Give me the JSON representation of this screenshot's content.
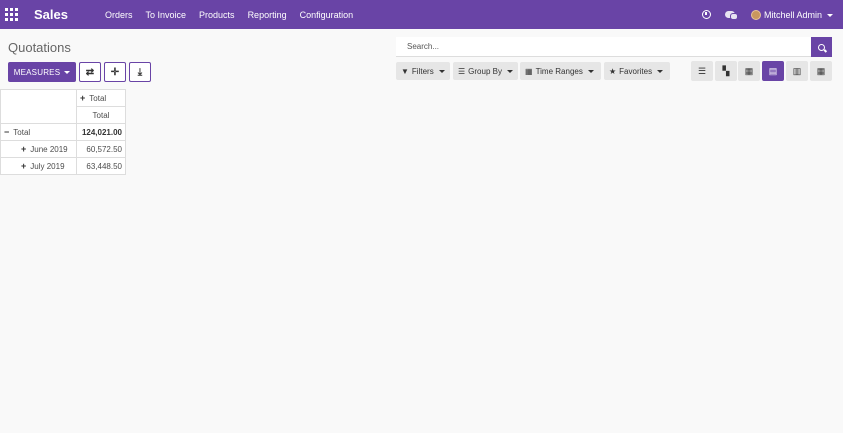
{
  "app": {
    "name": "Sales"
  },
  "nav": {
    "menu": [
      "Orders",
      "To Invoice",
      "Products",
      "Reporting",
      "Configuration"
    ],
    "user": "Mitchell Admin"
  },
  "page": {
    "title": "Quotations"
  },
  "toolbar": {
    "measures_label": "MEASURES"
  },
  "search": {
    "placeholder": "Search..."
  },
  "filters": {
    "filters_label": "Filters",
    "group_by_label": "Group By",
    "time_ranges_label": "Time Ranges",
    "favorites_label": "Favorites"
  },
  "views": {
    "active": "pivot",
    "icons": [
      "list-icon",
      "kanban-icon",
      "calendar-icon",
      "pivot-icon",
      "graph-icon",
      "grid-icon"
    ]
  },
  "pivot": {
    "col_header": "Total",
    "col_measure": "Total",
    "total_label": "Total",
    "total_value": "124,021.00",
    "rows": [
      {
        "label": "June 2019",
        "value": "60,572.50"
      },
      {
        "label": "July 2019",
        "value": "63,448.50"
      }
    ]
  },
  "colors": {
    "brand": "#6944a6",
    "background": "#f9f9f9"
  }
}
